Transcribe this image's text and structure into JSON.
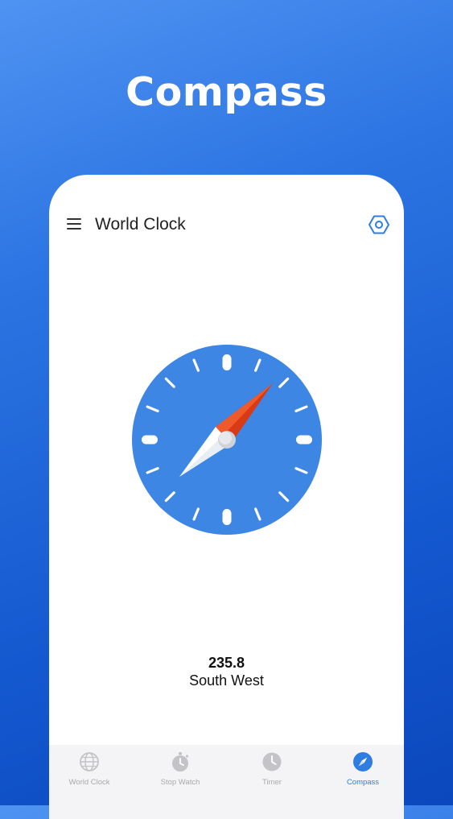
{
  "promo": {
    "title": "Compass"
  },
  "appbar": {
    "title": "World Clock"
  },
  "compass": {
    "heading_value": "235.8",
    "heading_direction": "South West",
    "dial_color": "#3d86e4",
    "needle_north_color": "#d73a14",
    "needle_south_color": "#ffffff"
  },
  "bottom_nav": {
    "items": [
      {
        "label": "World Clock",
        "icon": "globe-icon",
        "active": false
      },
      {
        "label": "Stop Watch",
        "icon": "stopwatch-icon",
        "active": false
      },
      {
        "label": "Timer",
        "icon": "clock-icon",
        "active": false
      },
      {
        "label": "Compass",
        "icon": "compass-icon",
        "active": true
      }
    ]
  },
  "colors": {
    "background_gradient_start": "#4f93f2",
    "background_gradient_end": "#0b47bd",
    "accent": "#2f7de1",
    "inactive": "#c4c4c8"
  }
}
